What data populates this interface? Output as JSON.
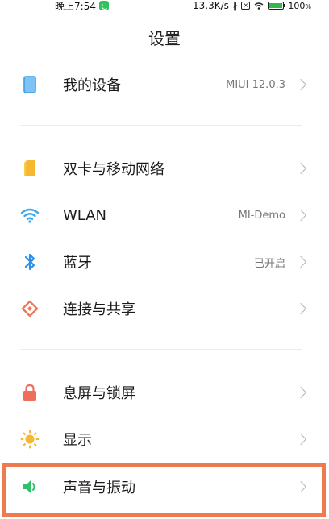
{
  "status_bar": {
    "time": "晚上7:54",
    "speed": "13.3K/s",
    "bluetooth": "∦",
    "sim": "×",
    "battery": "100",
    "battery_unit": "%"
  },
  "page": {
    "title": "设置"
  },
  "rows": [
    {
      "label": "我的设备",
      "value": "MIUI 12.0.3",
      "icon": "device-icon"
    },
    {
      "label": "双卡与移动网络",
      "value": "",
      "icon": "sim-card-icon"
    },
    {
      "label": "WLAN",
      "value": "MI-Demo",
      "icon": "wifi-icon"
    },
    {
      "label": "蓝牙",
      "value": "已开启",
      "icon": "bluetooth-icon"
    },
    {
      "label": "连接与共享",
      "value": "",
      "icon": "connection-share-icon"
    },
    {
      "label": "息屏与锁屏",
      "value": "",
      "icon": "lock-icon"
    },
    {
      "label": "显示",
      "value": "",
      "icon": "brightness-icon"
    },
    {
      "label": "声音与振动",
      "value": "",
      "icon": "speaker-icon"
    }
  ],
  "colors": {
    "device": "#3aa0ea",
    "sim": "#f5b830",
    "wifi": "#3aa6ec",
    "bluetooth": "#2f8fe6",
    "share": "#ee7a55",
    "lock": "#ee6e5e",
    "sun": "#f5b830",
    "speaker": "#2ec06a",
    "highlight": "#ee7b50"
  }
}
